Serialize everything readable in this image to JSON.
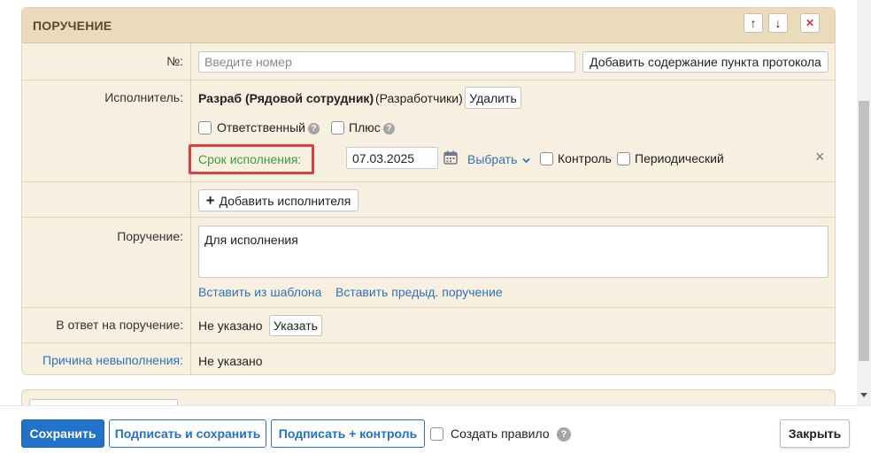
{
  "panel": {
    "title": "ПОРУЧЕНИЕ",
    "up_icon": "↑",
    "down_icon": "↓",
    "close_icon": "✕"
  },
  "number_row": {
    "label": "№:",
    "placeholder": "Введите номер",
    "add_content_label": "Добавить содержание пункта протокола"
  },
  "executor_row": {
    "label": "Исполнитель:",
    "name": "Разраб (Рядовой сотрудник)",
    "department": "(Разработчики)",
    "delete_label": "Удалить",
    "responsible_label": "Ответственный",
    "plus_label": "Плюс",
    "help_glyph": "?",
    "deadline_label": "Срок исполнения:",
    "deadline_value": "07.03.2025",
    "choose_label": "Выбрать",
    "control_label": "Контроль",
    "periodic_label": "Периодический",
    "remove_icon": "×"
  },
  "add_executor": {
    "label": "Добавить исполнителя",
    "plus_icon": "+"
  },
  "order_row": {
    "label": "Поручение:",
    "text": "Для исполнения",
    "insert_template": "Вставить из шаблона",
    "insert_previous": "Вставить предыд. поручение"
  },
  "reply_row": {
    "label": "В ответ на поручение:",
    "value": "Не указано",
    "specify_label": "Указать"
  },
  "reason_row": {
    "label": "Причина невыполнения:",
    "value": "Не указано"
  },
  "footer": {
    "save": "Сохранить",
    "sign_save": "Подписать и сохранить",
    "sign_control": "Подписать + контроль",
    "create_rule": "Создать правило",
    "help_glyph": "?",
    "close": "Закрыть"
  },
  "colors": {
    "panel_bg": "#f7f0e1",
    "header_bg": "#e9dbbb",
    "primary": "#2372c9",
    "link": "#2f72b8",
    "deadline_green": "#3c9b3c",
    "highlight_red": "#d9413f",
    "close_red": "#d33333"
  }
}
